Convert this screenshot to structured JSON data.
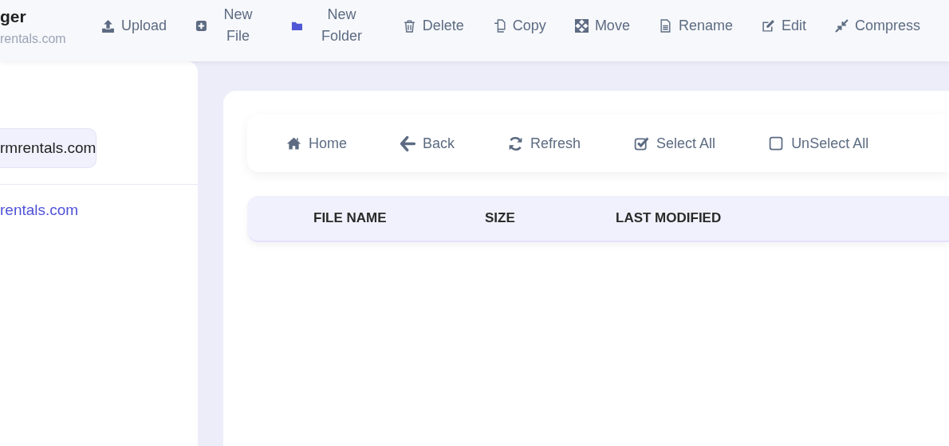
{
  "header": {
    "title": "ger",
    "subtitle": "rentals.com"
  },
  "toolbar": [
    "Upload",
    "New File",
    "New Folder",
    "Delete",
    "Copy",
    "Move",
    "Rename",
    "Edit",
    "Compress"
  ],
  "sidebar": {
    "items": [
      {
        "label": "rmrentals.com",
        "selected": true
      },
      {
        "label": "rentals.com",
        "selected": false
      }
    ]
  },
  "actions": [
    "Home",
    "Back",
    "Refresh",
    "Select All",
    "UnSelect All"
  ],
  "table": {
    "columns": [
      "FILE NAME",
      "SIZE",
      "LAST MODIFIED"
    ]
  }
}
